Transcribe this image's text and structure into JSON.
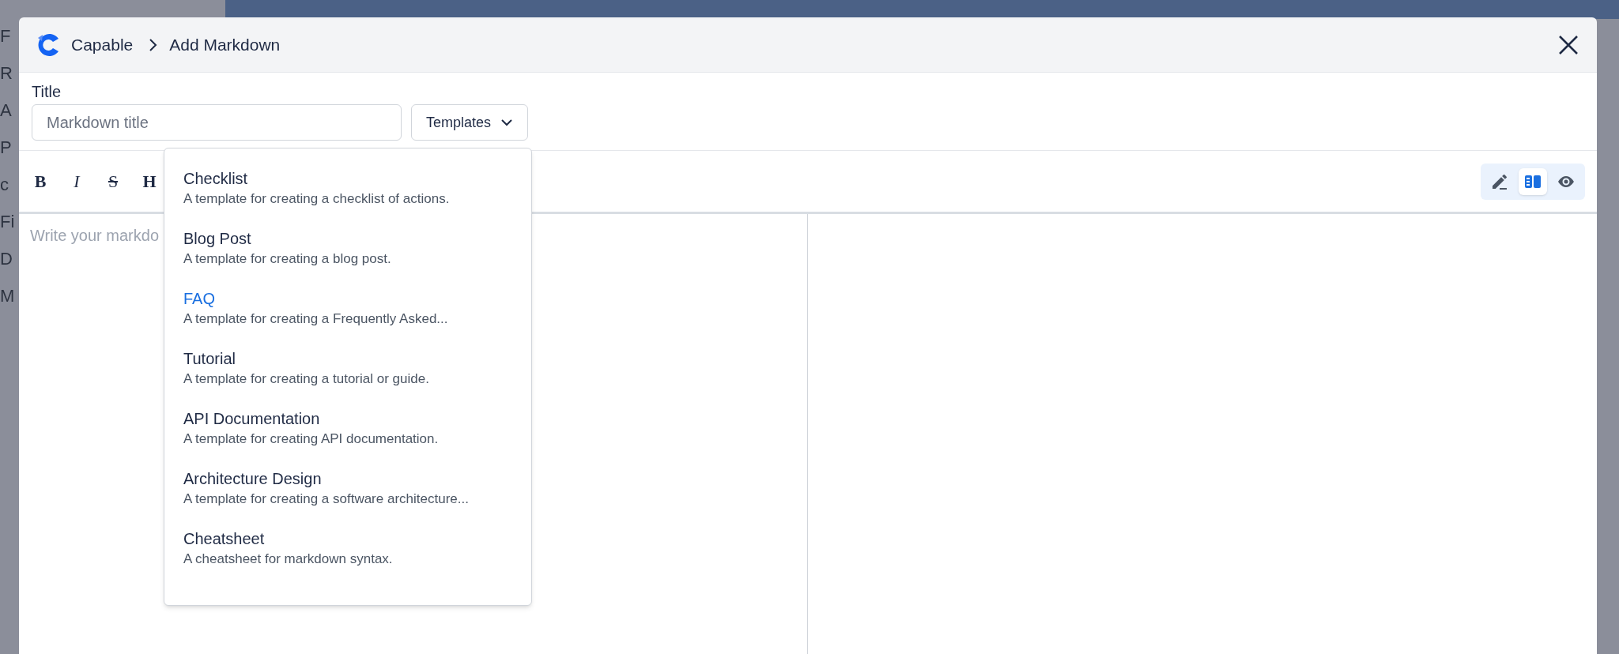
{
  "background": {
    "labels": [
      "F",
      "R",
      "A",
      "P",
      "c",
      "Fi",
      "D",
      "M"
    ]
  },
  "dialog": {
    "brand": "Capable",
    "breadcrumb": "Add Markdown"
  },
  "title_field": {
    "label": "Title",
    "placeholder": "Markdown title"
  },
  "templates_button": {
    "label": "Templates",
    "expanded": true
  },
  "templates_menu": [
    {
      "name": "Checklist",
      "description": "A template for creating a checklist of actions.",
      "selected": false
    },
    {
      "name": "Blog Post",
      "description": "A template for creating a blog post.",
      "selected": false
    },
    {
      "name": "FAQ",
      "description": "A template for creating a Frequently Asked...",
      "selected": true
    },
    {
      "name": "Tutorial",
      "description": "A template for creating a tutorial or guide.",
      "selected": false
    },
    {
      "name": "API Documentation",
      "description": "A template for creating API documentation.",
      "selected": false
    },
    {
      "name": "Architecture Design",
      "description": "A template for creating a software architecture...",
      "selected": false
    },
    {
      "name": "Cheatsheet",
      "description": "A cheatsheet for markdown syntax.",
      "selected": false
    }
  ],
  "format_buttons": [
    {
      "kind": "bold",
      "label": "B"
    },
    {
      "kind": "italic",
      "label": "I"
    },
    {
      "kind": "strike",
      "label": "S"
    },
    {
      "kind": "heading",
      "label": "H"
    }
  ],
  "view_modes": [
    {
      "kind": "edit",
      "selected": false
    },
    {
      "kind": "split",
      "selected": true
    },
    {
      "kind": "preview",
      "selected": false
    }
  ],
  "editor": {
    "placeholder": "Write your markdo"
  }
}
